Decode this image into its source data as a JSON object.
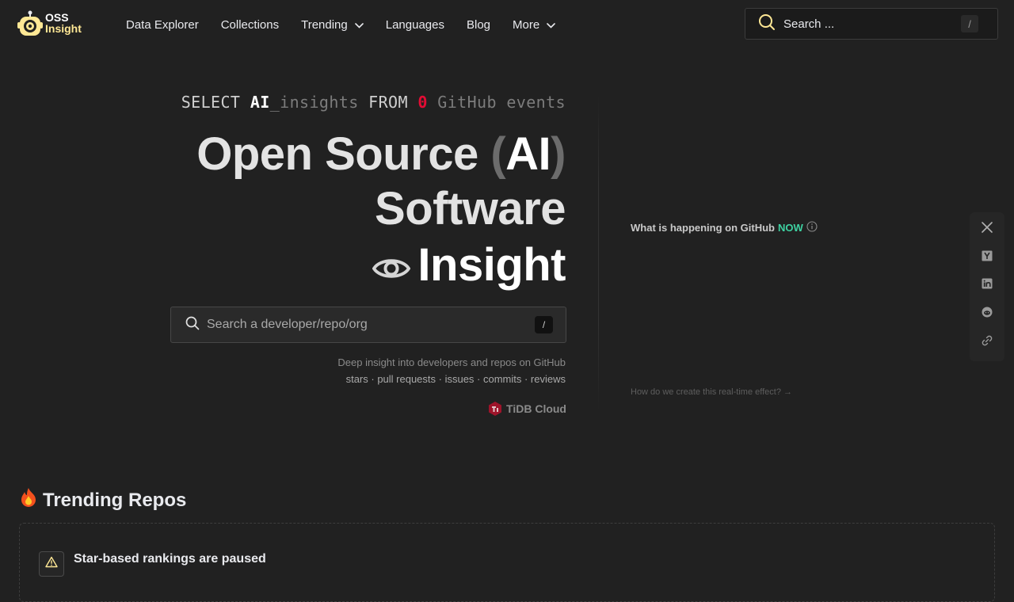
{
  "brand": {
    "line1": "OSS",
    "line2": "Insight",
    "colors": {
      "accent_yellow": "#ffe895",
      "background": "#212121",
      "now_green": "#3ed2a2",
      "sql_zero_red": "#e30c34"
    }
  },
  "nav": {
    "items": [
      {
        "label": "Data Explorer",
        "icon": null
      },
      {
        "label": "Collections",
        "icon": null
      },
      {
        "label": "Trending",
        "icon": "chevron-down-icon"
      },
      {
        "label": "Languages",
        "icon": null
      },
      {
        "label": "Blog",
        "icon": null
      },
      {
        "label": "More",
        "icon": "chevron-down-icon"
      }
    ],
    "search": {
      "placeholder": "Search ...",
      "shortcut": "/"
    }
  },
  "hero": {
    "sql": {
      "select": "SELECT",
      "ai": "AI",
      "insights": "_insights",
      "from": "FROM",
      "count": "0",
      "events": "GitHub events"
    },
    "title": {
      "line1_a": "Open Source",
      "paren_open": "(",
      "ai": "AI",
      "paren_close": ")",
      "line2": "Software",
      "line3": "Insight"
    },
    "search": {
      "placeholder": "Search a developer/repo/org",
      "shortcut": "/"
    },
    "description_line1": "Deep insight into developers and repos on GitHub",
    "description_line2": "stars · pull requests · issues · commits · reviews",
    "powered_by": "TiDB Cloud"
  },
  "realtime": {
    "title": "What is happening on GitHub",
    "now": "NOW",
    "link": "How do we create this real-time effect? →"
  },
  "social": {
    "buttons": [
      "x-icon",
      "ycombinator-icon",
      "linkedin-icon",
      "reddit-icon",
      "link-icon"
    ]
  },
  "trending": {
    "title": "Trending Repos",
    "notice": "Star-based rankings are paused"
  }
}
